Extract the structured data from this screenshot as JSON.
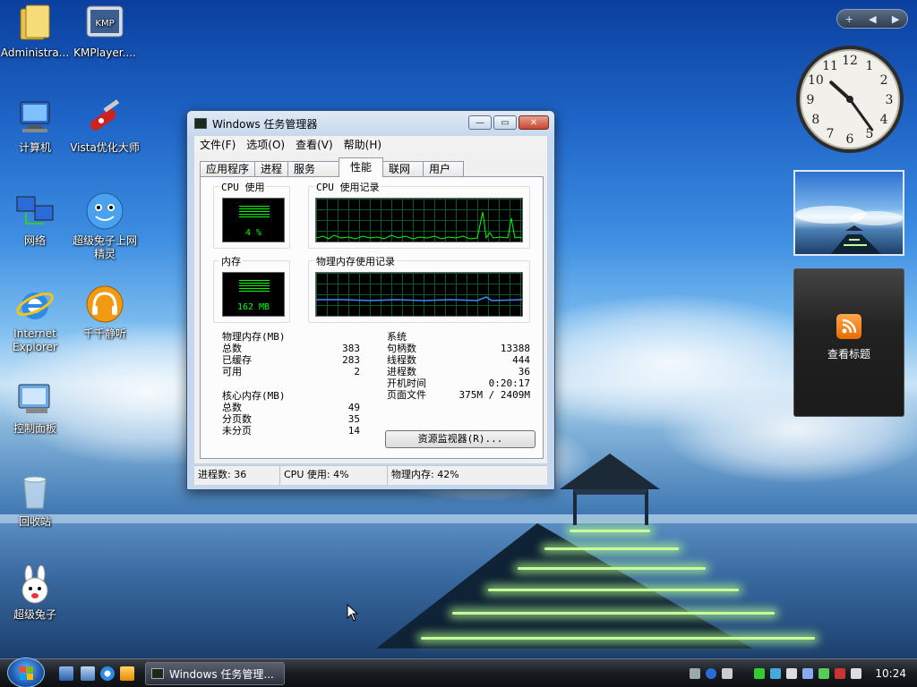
{
  "desktop": {
    "icons": [
      {
        "label": "Administra..."
      },
      {
        "label": "KMPlayer...."
      },
      {
        "label": "计算机"
      },
      {
        "label": "Vista优化大师"
      },
      {
        "label": "网络"
      },
      {
        "label": "超级兔子上网精灵"
      },
      {
        "label": "Internet Explorer"
      },
      {
        "label": "千千静听"
      },
      {
        "label": "控制面板"
      },
      {
        "label": "回收站"
      },
      {
        "label": "超级兔子"
      }
    ]
  },
  "sidebar": {
    "gadget_add": "+",
    "gadget_prev": "◀",
    "gadget_next": "▶",
    "clock": {
      "hour": 10,
      "minute": 24,
      "numbers": [
        "12",
        "1",
        "2",
        "3",
        "4",
        "5",
        "6",
        "7",
        "8",
        "9",
        "10",
        "11"
      ]
    },
    "feeds_label": "查看标题"
  },
  "window": {
    "title": "Windows 任务管理器",
    "menu": [
      "文件(F)",
      "选项(O)",
      "查看(V)",
      "帮助(H)"
    ],
    "tabs": [
      "应用程序",
      "进程",
      "服务",
      "性能",
      "联网",
      "用户"
    ],
    "active_tab": "性能",
    "cpu_usage_label": "CPU 使用",
    "cpu_usage_value": "4 %",
    "cpu_history_label": "CPU 使用记录",
    "memory_label": "内存",
    "memory_value": "162 MB",
    "memory_history_label": "物理内存使用记录",
    "physical_memory": {
      "title": "物理内存(MB)",
      "rows": [
        {
          "label": "总数",
          "value": "383"
        },
        {
          "label": "已缓存",
          "value": "283"
        },
        {
          "label": "可用",
          "value": "2"
        }
      ]
    },
    "kernel_memory": {
      "title": "核心内存(MB)",
      "rows": [
        {
          "label": "总数",
          "value": "49"
        },
        {
          "label": "分页数",
          "value": "35"
        },
        {
          "label": "未分页",
          "value": "14"
        }
      ]
    },
    "system": {
      "title": "系统",
      "rows": [
        {
          "label": "句柄数",
          "value": "13388"
        },
        {
          "label": "线程数",
          "value": "444"
        },
        {
          "label": "进程数",
          "value": "36"
        },
        {
          "label": "开机时间",
          "value": "0:20:17"
        },
        {
          "label": "页面文件",
          "value": "375M / 2409M"
        }
      ]
    },
    "resource_monitor_button": "资源监视器(R)...",
    "status": {
      "processes": "进程数: 36",
      "cpu": "CPU 使用: 4%",
      "memory": "物理内存: 42%"
    }
  },
  "taskbar": {
    "task_button": "Windows 任务管理...",
    "clock": "10:24"
  }
}
